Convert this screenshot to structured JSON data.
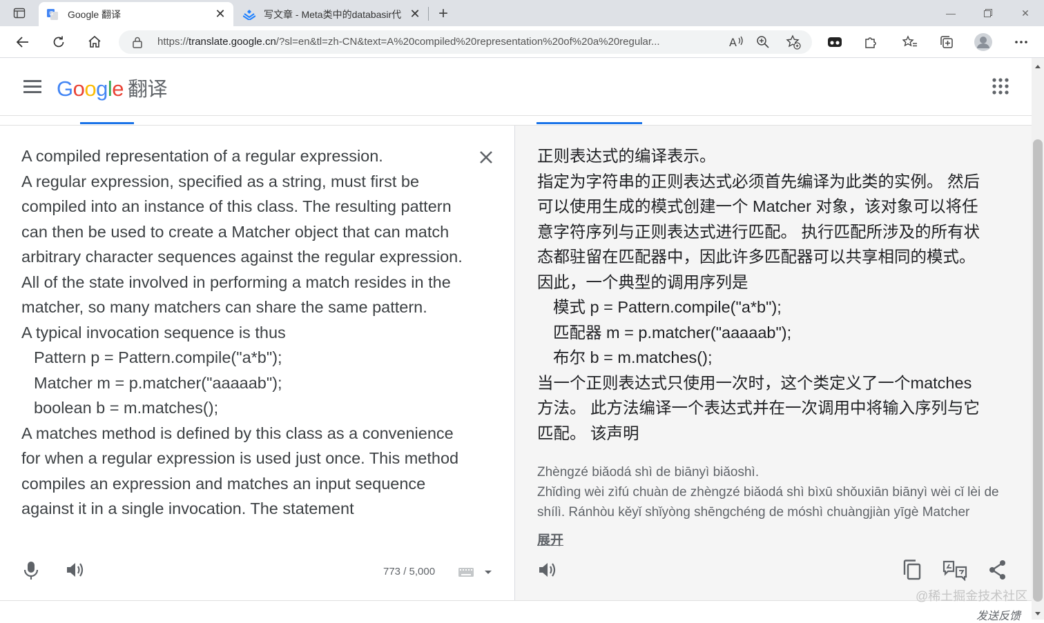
{
  "browser": {
    "tabs": [
      {
        "title": "Google 翻译",
        "active": true,
        "favicon": "google-translate-icon"
      },
      {
        "title": "写文章 - Meta类中的databasir代",
        "active": false,
        "favicon": "juejin-icon"
      }
    ],
    "url_prefix": "https://",
    "url_host": "translate.google.cn",
    "url_rest": "/?sl=en&tl=zh-CN&text=A%20compiled%20representation%20of%20a%20regular..."
  },
  "header": {
    "logo_letters": [
      "G",
      "o",
      "o",
      "g",
      "l",
      "e"
    ],
    "product_name": "翻译"
  },
  "source": {
    "lines": [
      "A compiled representation of a regular expression.",
      "A regular expression, specified as a string, must first be",
      "compiled into an instance of this class. The resulting pattern",
      "can then be used to create a Matcher object that can match",
      "arbitrary character sequences against the regular expression.",
      "All of the state involved in performing a match resides in the",
      "matcher, so many matchers can share the same pattern.",
      "A typical invocation sequence is thus",
      "Pattern p = Pattern.compile(\"a*b\");",
      "Matcher m = p.matcher(\"aaaaab\");",
      "boolean b = m.matches();",
      "A matches method is defined by this class as a convenience",
      "for when a regular expression is used just once. This method",
      "compiles an expression and matches an input sequence",
      "against it in a single invocation. The statement"
    ],
    "char_count": "773 / 5,000"
  },
  "target": {
    "lines": [
      "正则表达式的编译表示。",
      "指定为字符串的正则表达式必须首先编译为此类的实例。 然后",
      "可以使用生成的模式创建一个 Matcher 对象，该对象可以将任",
      "意字符序列与正则表达式进行匹配。 执行匹配所涉及的所有状",
      "态都驻留在匹配器中，因此许多匹配器可以共享相同的模式。",
      "因此，一个典型的调用序列是",
      "模式 p = Pattern.compile(\"a*b\");",
      "匹配器 m = p.matcher(\"aaaaab\");",
      "布尔 b = m.matches();",
      "当一个正则表达式只使用一次时，这个类定义了一个matches",
      "方法。 此方法编译一个表达式并在一次调用中将输入序列与它",
      "匹配。 该声明"
    ],
    "romanization": [
      "Zhèngzé biǎodá shì de biānyì biǎoshì.",
      "Zhǐdìng wèi zìfú chuàn de zhèngzé biǎodá shì bìxū shǒuxiān biānyì wèi cǐ lèi de",
      "shílì. Ránhòu kěyǐ shǐyòng shēngchéng de móshì chuàngjiàn yīgè Matcher"
    ],
    "expand_label": "展开"
  },
  "footer": {
    "watermark": "@稀土掘金技术社区",
    "feedback": "发送反馈"
  },
  "colors": {
    "google_blue": "#4285f4",
    "google_red": "#ea4335",
    "google_yellow": "#fbbc05",
    "google_green": "#34a853",
    "accent": "#1a73e8",
    "target_bg": "#f5f5f5"
  }
}
